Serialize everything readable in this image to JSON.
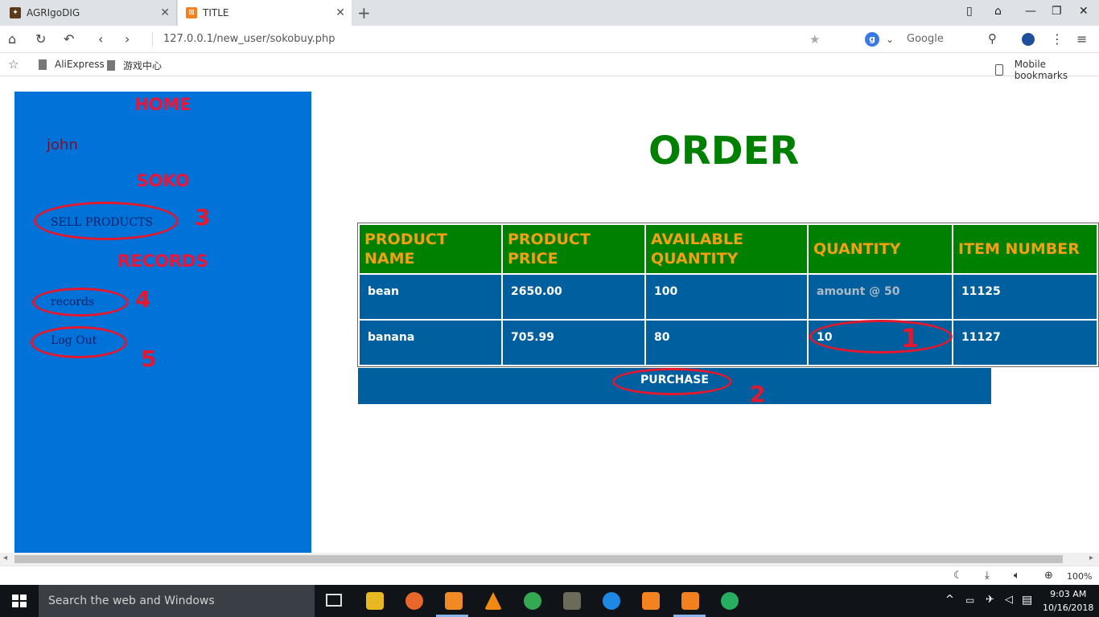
{
  "browser": {
    "tabs": [
      {
        "label": "AGRIgoDIG"
      },
      {
        "label": "TITLE"
      }
    ],
    "url": "127.0.0.1/new_user/sokobuy.php",
    "search_engine": "Google",
    "bookmarks": [
      "AliExpress",
      "游戏中心"
    ],
    "mobile_bookmarks": "Mobile bookmarks",
    "zoom": "100%"
  },
  "sidebar": {
    "home": "HOME",
    "username": "john",
    "soko": "SOKO",
    "sell_products": "SELL PRODUCTS",
    "records_heading": "RECORDS",
    "records_link": "records",
    "logout": "Log Out"
  },
  "main": {
    "title": "ORDER",
    "table": {
      "headers": [
        "PRODUCT NAME",
        "PRODUCT PRICE",
        "AVAILABLE QUANTITY",
        "QUANTITY",
        "ITEM NUMBER"
      ],
      "rows": [
        {
          "name": "bean",
          "price": "2650.00",
          "available": "100",
          "quantity_placeholder": "amount @ 50",
          "item_number": "11125"
        },
        {
          "name": "banana",
          "price": "705.99",
          "available": "80",
          "quantity": "10",
          "item_number": "11127"
        }
      ]
    },
    "purchase_label": "PURCHASE"
  },
  "annotations": [
    "1",
    "2",
    "3",
    "4",
    "5"
  ],
  "taskbar": {
    "search_placeholder": "Search the web and Windows",
    "time": "9:03 AM",
    "date": "10/16/2018"
  },
  "colors": {
    "sidebar_bg": "#0072d8",
    "heading_red": "#e8163b",
    "order_green": "#008000",
    "header_gold": "#f0a010",
    "cell_blue": "#005f9e",
    "annotation_red": "#e3182e"
  }
}
